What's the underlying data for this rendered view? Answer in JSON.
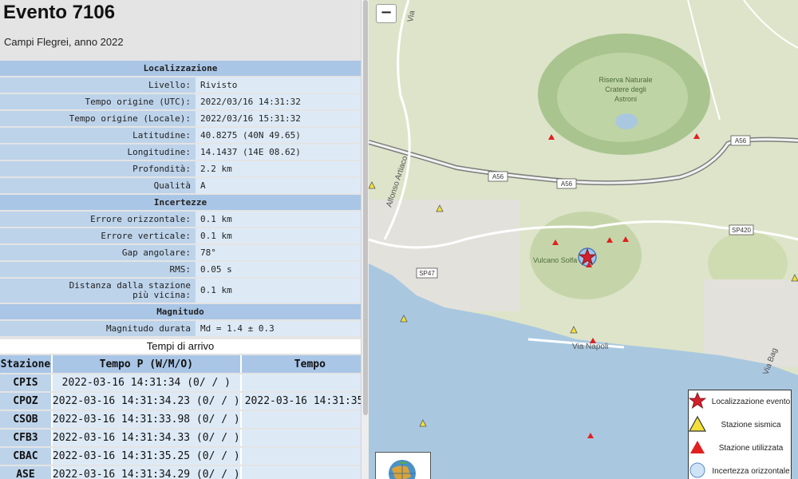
{
  "header": {
    "title": "Evento 7106",
    "subtitle": "Campi Flegrei, anno 2022"
  },
  "info": {
    "loc_header": "Localizzazione",
    "livello": {
      "key": "Livello:",
      "value": "Rivisto"
    },
    "utc": {
      "key": "Tempo origine (UTC):",
      "value": "2022/03/16 14:31:32"
    },
    "locale": {
      "key": "Tempo origine (Locale):",
      "value": "2022/03/16 15:31:32"
    },
    "lat": {
      "key": "Latitudine:",
      "value": "40.8275 (40N 49.65)"
    },
    "lon": {
      "key": "Longitudine:",
      "value": "14.1437 (14E 08.62)"
    },
    "depth": {
      "key": "Profondità:",
      "value": "2.2 km"
    },
    "quality": {
      "key": "Qualità",
      "value": "A"
    },
    "unc_header": "Incertezze",
    "err_h": {
      "key": "Errore orizzontale:",
      "value": "0.1 km"
    },
    "err_v": {
      "key": "Errore verticale:",
      "value": "0.1 km"
    },
    "gap": {
      "key": "Gap angolare:",
      "value": "78°"
    },
    "rms": {
      "key": "RMS:",
      "value": "0.05 s"
    },
    "dist": {
      "key_line1": "Distanza dalla stazione",
      "key_line2": "più vicina:",
      "value": "0.1 km"
    },
    "mag_header": "Magnitudo",
    "md": {
      "key": "Magnitudo durata",
      "value": "Md = 1.4 ± 0.3"
    }
  },
  "arrivals": {
    "title": "Tempi di arrivo",
    "col_station": "Stazione",
    "col_p": "Tempo P (W/M/O)",
    "col_s": "Tempo",
    "rows": [
      {
        "station": "CPIS",
        "p": "2022-03-16 14:31:34 (0/ / )",
        "s": ""
      },
      {
        "station": "CPOZ",
        "p": "2022-03-16 14:31:34.23 (0/ / )",
        "s": "2022-03-16 14:31:35"
      },
      {
        "station": "CSOB",
        "p": "2022-03-16 14:31:33.98 (0/ / )",
        "s": ""
      },
      {
        "station": "CFB3",
        "p": "2022-03-16 14:31:34.33 (0/ / )",
        "s": ""
      },
      {
        "station": "CBAC",
        "p": "2022-03-16 14:31:35.25 (0/ / )",
        "s": ""
      },
      {
        "station": "ASE",
        "p": "2022-03-16 14:31:34.29 (0/ / )",
        "s": ""
      }
    ]
  },
  "map": {
    "zoom_out": "−",
    "labels": {
      "reserve1": "Riserva Naturale",
      "reserve2": "Cratere degli",
      "reserve3": "Astroni",
      "solfatara": "Vulcano Solfa",
      "a56_1": "A56",
      "a56_2": "A56",
      "a56_3": "A56",
      "sp420": "SP420",
      "sp47": "SP47",
      "via_napoli": "Via Napoli",
      "via_artiaco": "Alfonso Artiaco",
      "via_top": "Via",
      "via_bag": "Via Bag"
    },
    "legend": {
      "event": "Localizzazione evento",
      "station": "Stazione sismica",
      "used": "Stazione utilizzata",
      "uncertainty": "Incertezza orizzontale"
    },
    "colors": {
      "sea": "#a9c8e0",
      "land": "#dde4c9",
      "event_star": "#d0202c",
      "station_yellow": "#f3e03a",
      "station_red": "#e02020",
      "uncertainty": "#9fc3ee"
    }
  }
}
